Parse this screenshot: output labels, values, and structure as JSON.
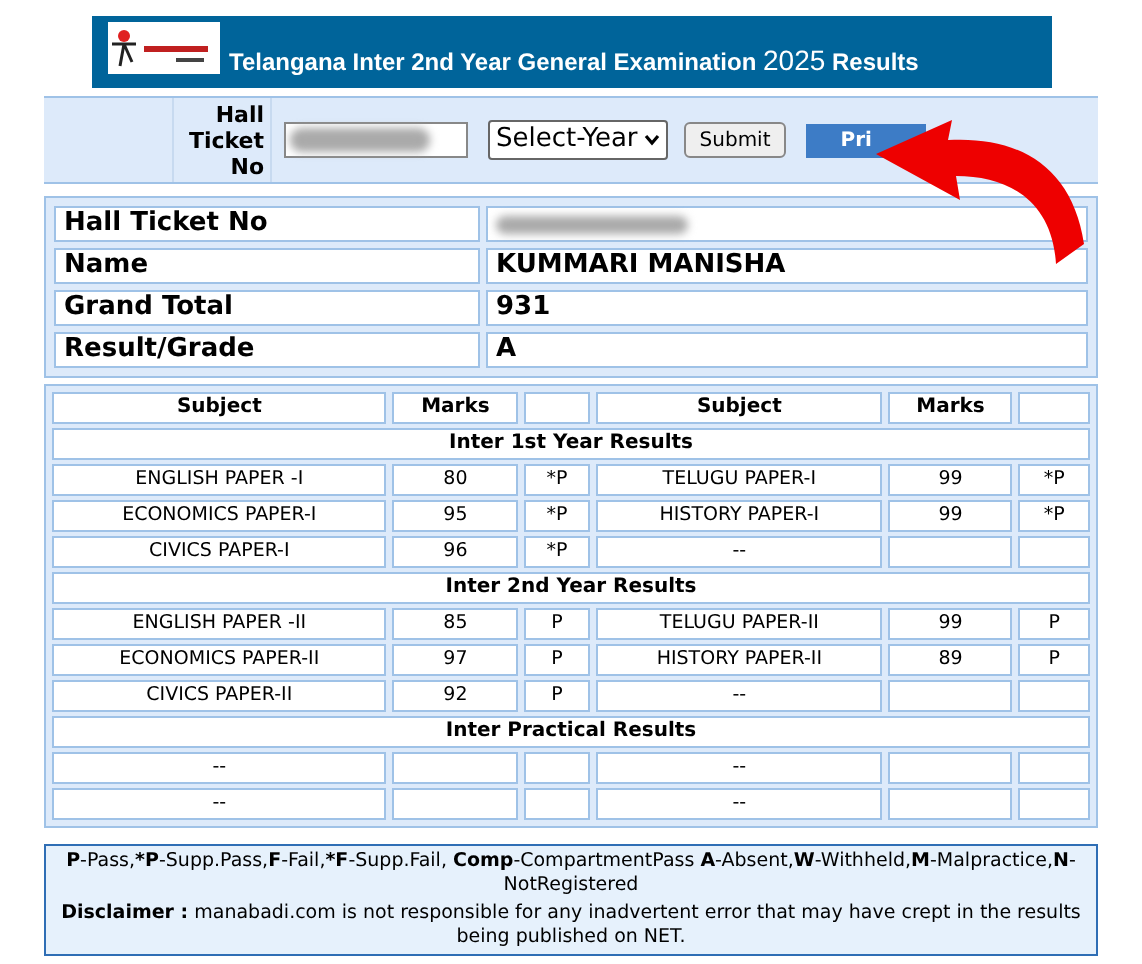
{
  "banner": {
    "title": "Telangana Inter 2nd Year General Examination",
    "year": "2025",
    "suffix": "Results"
  },
  "form": {
    "label": "Hall Ticket No",
    "year_select": "Select-Year",
    "submit": "Submit",
    "print": "Pri"
  },
  "info": [
    {
      "label": "Hall Ticket No",
      "kind": "redacted"
    },
    {
      "label": "Name",
      "value": "KUMMARI MANISHA",
      "kind": "text"
    },
    {
      "label": "Grand Total",
      "value": "931",
      "kind": "text"
    },
    {
      "label": "Result/Grade",
      "value": "A",
      "kind": "text"
    }
  ],
  "results": [
    {
      "kind": "header",
      "cells": [
        "Subject",
        "Marks",
        "",
        "Subject",
        "Marks",
        ""
      ]
    },
    {
      "kind": "section",
      "title": "Inter 1st Year Results"
    },
    {
      "kind": "row",
      "cells": [
        "ENGLISH PAPER -I",
        "80",
        "*P",
        "TELUGU PAPER-I",
        "99",
        "*P"
      ]
    },
    {
      "kind": "row",
      "cells": [
        "ECONOMICS PAPER-I",
        "95",
        "*P",
        "HISTORY PAPER-I",
        "99",
        "*P"
      ]
    },
    {
      "kind": "row",
      "cells": [
        "CIVICS PAPER-I",
        "96",
        "*P",
        "--",
        "",
        ""
      ]
    },
    {
      "kind": "section",
      "title": "Inter 2nd Year Results"
    },
    {
      "kind": "row",
      "cells": [
        "ENGLISH PAPER -II",
        "85",
        "P",
        "TELUGU PAPER-II",
        "99",
        "P"
      ]
    },
    {
      "kind": "row",
      "cells": [
        "ECONOMICS PAPER-II",
        "97",
        "P",
        "HISTORY PAPER-II",
        "89",
        "P"
      ]
    },
    {
      "kind": "row",
      "cells": [
        "CIVICS PAPER-II",
        "92",
        "P",
        "--",
        "",
        ""
      ]
    },
    {
      "kind": "section",
      "title": "Inter Practical Results"
    },
    {
      "kind": "row",
      "cells": [
        "--",
        "",
        "",
        "--",
        "",
        ""
      ]
    },
    {
      "kind": "row",
      "cells": [
        "--",
        "",
        "",
        "--",
        "",
        ""
      ]
    }
  ],
  "legend": "**P**-Pass,***P**-Supp.Pass,**F**-Fail,***F**-Supp.Fail, **Comp**-CompartmentPass **A**-Absent,**W**-Withheld,**M**-Malpractice,**N**-NotRegistered",
  "disclaimer": {
    "label": "Disclaimer :",
    "text": "manabadi.com is not responsible for any inadvertent error that may have crept in the results being published on NET."
  }
}
